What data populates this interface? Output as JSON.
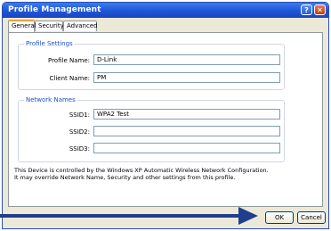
{
  "window": {
    "title": "Profile Management"
  },
  "tabs": [
    {
      "label": "General"
    },
    {
      "label": "Security"
    },
    {
      "label": "Advanced"
    }
  ],
  "profile_settings": {
    "legend": "Profile Settings",
    "profile_name_label": "Profile Name:",
    "profile_name_value": "D-Link",
    "client_name_label": "Client Name:",
    "client_name_value": "PM"
  },
  "network_names": {
    "legend": "Network Names",
    "ssid1_label": "SSID1:",
    "ssid1_value": "WPA2 Test",
    "ssid2_label": "SSID2:",
    "ssid2_value": "",
    "ssid3_label": "SSID3:",
    "ssid3_value": ""
  },
  "info_text": "This Device is controlled by the Windows XP Automatic Wireless Network Configuration. It may override Network Name, Security and other settings from this profile.",
  "buttons": {
    "ok": "OK",
    "cancel": "Cancel"
  },
  "annotations": {
    "arrow_color": "#1f3f8c"
  }
}
